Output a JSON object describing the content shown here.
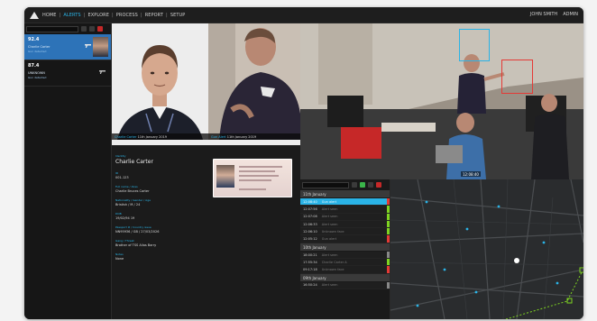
{
  "nav": {
    "items": [
      {
        "label": "HOME"
      },
      {
        "label": "ALERTS",
        "active": true
      },
      {
        "label": "EXPLORE"
      },
      {
        "label": "PROCESS"
      },
      {
        "label": "REPORT"
      },
      {
        "label": "SETUP"
      }
    ],
    "separator": "|",
    "user_name": "JOHN SMITH",
    "admin_label": "ADMIN"
  },
  "alerts": [
    {
      "title": "92.4",
      "name": "Charlie Carter",
      "sub": "Gun detected"
    },
    {
      "title": "87.4",
      "name": "UNKNOWN",
      "sub": "Gun detected"
    }
  ],
  "photo_panel": {
    "face_caption_name": "Charlie Carter",
    "face_caption_time": "11th January 2019",
    "crop_caption_name": "Gun Alert",
    "crop_caption_time": "11th January 2019"
  },
  "details": {
    "identity_label": "Identity",
    "identity_value": "Charlie Carter",
    "id_label": "ID",
    "id_value": "001-123",
    "full_name_label": "Full name / Alias",
    "full_name_value": "Charlie Bruces Carter",
    "nationality_label": "Nationality / Gender / Age",
    "nationality_value": "Bristish / M / 24",
    "dob_label": "DOB",
    "dob_value": "19/02/94 19",
    "passport_label": "Passport # / Country issue",
    "passport_value": "NN95936 / GB / 27/03/2026",
    "gang_label": "Gang / Threat",
    "gang_value": "Brother of TSS Alias Barry",
    "notes_label": "Notes",
    "notes_value": "None"
  },
  "scene": {
    "timestamp": "12:08:40"
  },
  "timeline": {
    "sections": [
      {
        "label": "11th January",
        "rows": [
          {
            "time": "12:08:40",
            "desc": "Gun alert",
            "flag": "#e53935",
            "selected": true
          },
          {
            "time": "12:07:56",
            "desc": "Alert seen",
            "flag": "#7ed321"
          },
          {
            "time": "12:07:08",
            "desc": "Alert seen",
            "flag": "#7ed321"
          },
          {
            "time": "12:06:33",
            "desc": "Alert seen",
            "flag": "#7ed321"
          },
          {
            "time": "12:06:10",
            "desc": "Unknown face",
            "flag": "#7ed321"
          },
          {
            "time": "12:05:12",
            "desc": "Gun alert",
            "flag": "#e53935"
          }
        ]
      },
      {
        "label": "10th January",
        "rows": [
          {
            "time": "18:00:21",
            "desc": "Alert seen",
            "flag": "#888888"
          },
          {
            "time": "17:55:34",
            "desc": "Charlie Carter A",
            "flag": "#7ed321"
          },
          {
            "time": "09:17:18",
            "desc": "Unknown face",
            "flag": "#e53935"
          }
        ]
      },
      {
        "label": "09th January",
        "rows": [
          {
            "time": "16:50:24",
            "desc": "Alert seen",
            "flag": "#888888"
          }
        ]
      }
    ]
  },
  "colors": {
    "accent": "#2ab3e6",
    "selected_alert": "#2d73b8",
    "alert_red": "#e53935",
    "ok_green": "#7ed321"
  },
  "icons": [
    "home-logo-icon",
    "search-icon",
    "gun-icon",
    "close-icon",
    "location-pin-icon"
  ]
}
